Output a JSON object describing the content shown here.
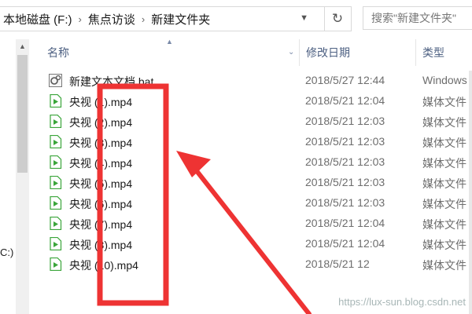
{
  "address": {
    "crumbs": [
      "本地磁盘 (F:)",
      "焦点访谈",
      "新建文件夹"
    ],
    "search_placeholder": "搜索\"新建文件夹\""
  },
  "columns": {
    "name": "名称",
    "date": "修改日期",
    "type": "类型"
  },
  "files": [
    {
      "icon": "bat-file-icon",
      "name": "新建文本文档.bat",
      "date": "2018/5/27 12:44",
      "type": "Windows"
    },
    {
      "icon": "video-file-icon",
      "name": "央视 (1).mp4",
      "date": "2018/5/21 12:04",
      "type": "媒体文件"
    },
    {
      "icon": "video-file-icon",
      "name": "央视 (2).mp4",
      "date": "2018/5/21 12:03",
      "type": "媒体文件"
    },
    {
      "icon": "video-file-icon",
      "name": "央视 (3).mp4",
      "date": "2018/5/21 12:03",
      "type": "媒体文件"
    },
    {
      "icon": "video-file-icon",
      "name": "央视 (4).mp4",
      "date": "2018/5/21 12:03",
      "type": "媒体文件"
    },
    {
      "icon": "video-file-icon",
      "name": "央视 (5).mp4",
      "date": "2018/5/21 12:03",
      "type": "媒体文件"
    },
    {
      "icon": "video-file-icon",
      "name": "央视 (6).mp4",
      "date": "2018/5/21 12:03",
      "type": "媒体文件"
    },
    {
      "icon": "video-file-icon",
      "name": "央视 (7).mp4",
      "date": "2018/5/21 12:04",
      "type": "媒体文件"
    },
    {
      "icon": "video-file-icon",
      "name": "央视 (8).mp4",
      "date": "2018/5/21 12:04",
      "type": "媒体文件"
    },
    {
      "icon": "video-file-icon",
      "name": "央视 (10).mp4",
      "date": "2018/5/21 12",
      "type": "媒体文件"
    }
  ],
  "sidebar_cut_text": "C:)",
  "watermark": "https://lux-sun.blog.csdn.net",
  "colors": {
    "highlight_red": "#ee3333",
    "header_text": "#4d6082",
    "video_icon_green": "#3aa53a"
  }
}
